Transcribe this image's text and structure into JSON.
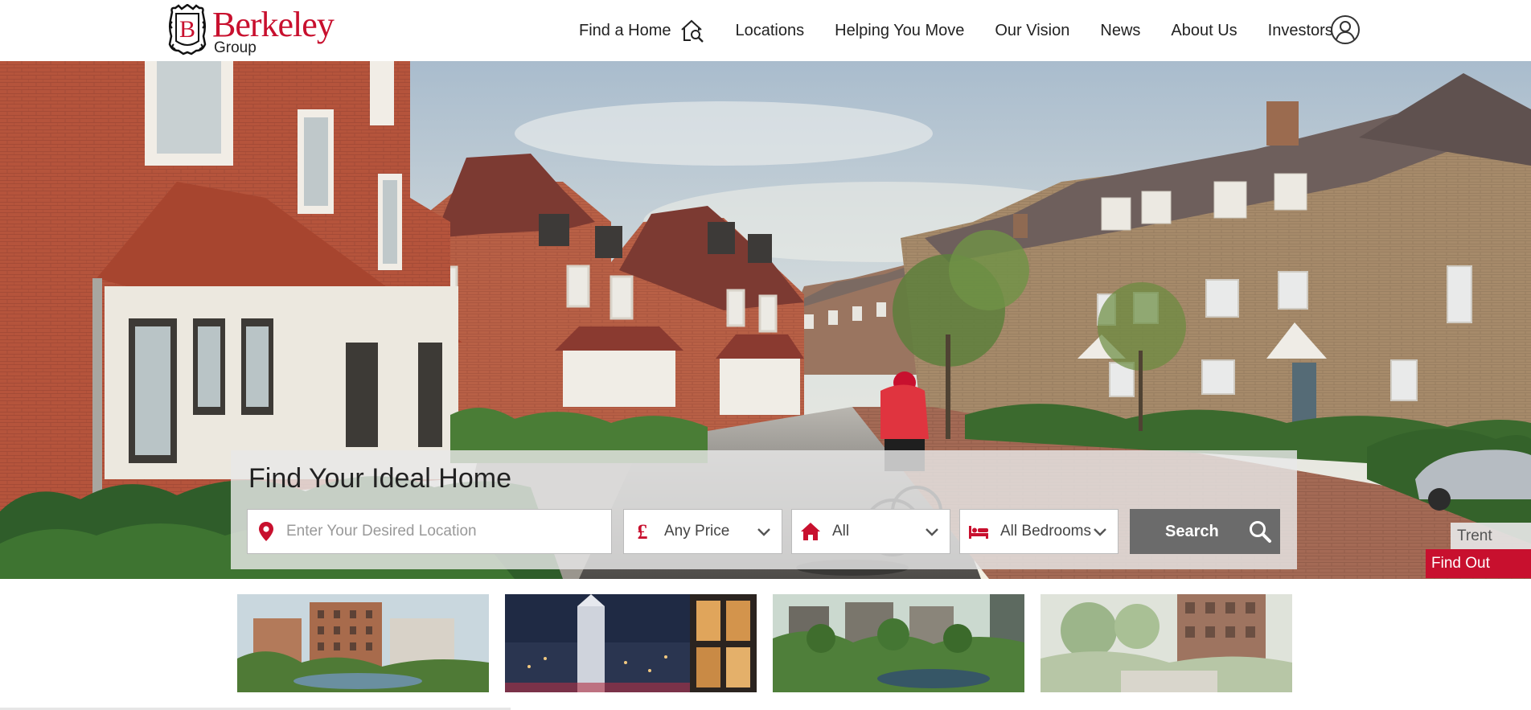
{
  "brand": {
    "name": "Berkeley",
    "sub": "Group",
    "crest_letter": "B",
    "color": "#c8102e"
  },
  "nav": {
    "items": [
      {
        "label": "Find a Home",
        "icon": "house-search-icon"
      },
      {
        "label": "Locations"
      },
      {
        "label": "Helping You Move"
      },
      {
        "label": "Our Vision"
      },
      {
        "label": "News"
      },
      {
        "label": "About Us"
      },
      {
        "label": "Investors"
      }
    ],
    "account_icon": "user-account-icon"
  },
  "search": {
    "title": "Find Your Ideal Home",
    "location_placeholder": "Enter Your Desired Location",
    "location_icon": "map-pin-icon",
    "price": {
      "value": "Any Price",
      "icon": "pound-icon"
    },
    "type": {
      "value": "All",
      "icon": "house-icon"
    },
    "bedrooms": {
      "value": "All Bedrooms",
      "icon": "bed-icon"
    },
    "button_label": "Search",
    "button_icon": "search-icon",
    "accent_color": "#c8102e",
    "button_color": "#6b6b6b"
  },
  "hero": {
    "development_name": "Trent Park",
    "cta_label": "Find Out More"
  },
  "thumbnails": [
    {
      "name": "development-thumbnail-1"
    },
    {
      "name": "development-thumbnail-2"
    },
    {
      "name": "development-thumbnail-3"
    },
    {
      "name": "development-thumbnail-4"
    }
  ]
}
